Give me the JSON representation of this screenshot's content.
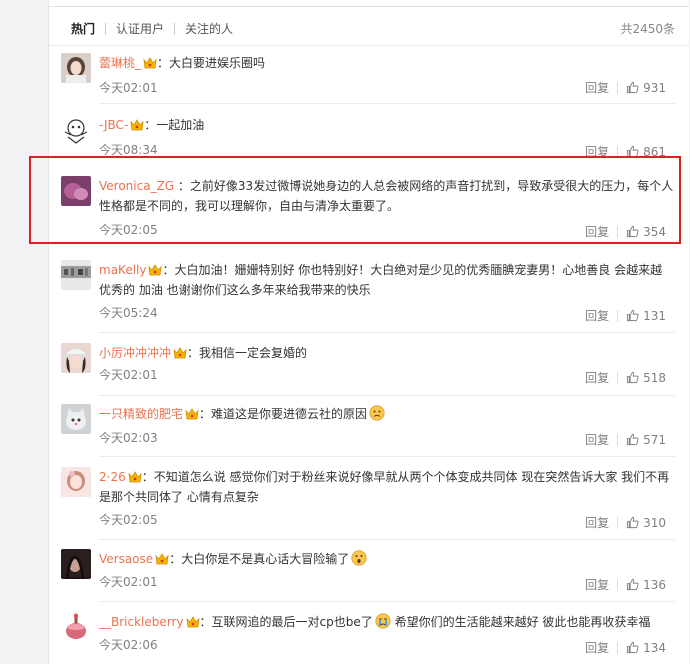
{
  "tabs": [
    {
      "label": "热门",
      "active": true
    },
    {
      "label": "认证用户",
      "active": false
    },
    {
      "label": "关注的人",
      "active": false
    }
  ],
  "total": "共2450条",
  "reply_label": "回复",
  "colors": {
    "username": "#eb7350",
    "highlight": "#e02020",
    "meta": "#808080"
  },
  "comments": [
    {
      "user": "蕾琳桃_",
      "text": "：大白要进娱乐圈吗",
      "time": "今天02:01",
      "likes": "931",
      "avatar": "girl-avatar"
    },
    {
      "user": "-JBC-",
      "text": "：一起加油",
      "time": "今天08:34",
      "likes": "861",
      "avatar": "cartoon-avatar"
    },
    {
      "user": "Veronica_ZG",
      "text": "：之前好像33发过微博说她身边的人总会被网络的声音打扰到，导致承受很大的压力，每个人性格都是不同的，我可以理解你，自由与清净太重要了。",
      "time": "今天02:05",
      "likes": "354",
      "avatar": "purple-avatar"
    },
    {
      "user": "maKelly",
      "text": "：大白加油！姗姗特别好 你也特别好！大白绝对是少见的优秀腼腆宠妻男！心地善良 会越来越优秀的 加油 也谢谢你们这么多年来给我带来的快乐",
      "time": "今天05:24",
      "likes": "131",
      "avatar": "gray-avatar"
    },
    {
      "user": "小厉冲冲冲冲",
      "text": "：我相信一定会复婚的",
      "time": "今天02:01",
      "likes": "518",
      "avatar": "hat-avatar"
    },
    {
      "user": "一只精致的肥宅",
      "text": "：难道这是你要进德云社的原因",
      "time": "今天02:03",
      "likes": "571",
      "avatar": "cat-avatar"
    },
    {
      "user": "2·26",
      "text": "：不知道怎么说 感觉你们对于粉丝来说好像早就从两个个体变成共同体 现在突然告诉大家 我们不再是那个共同体了 心情有点复杂",
      "time": "今天02:05",
      "likes": "310",
      "avatar": "pink-avatar"
    },
    {
      "user": "Versaose",
      "text": "：大白你是不是真心话大冒险输了",
      "time": "今天02:01",
      "likes": "136",
      "avatar": "dark-avatar"
    },
    {
      "user": "__Brickleberry",
      "text": "：互联网追的最后一对cp也be了",
      "text2": "希望你们的生活能越来越好 彼此也能再收获幸福",
      "time": "今天02:06",
      "likes": "134",
      "avatar": "cake-avatar"
    }
  ]
}
